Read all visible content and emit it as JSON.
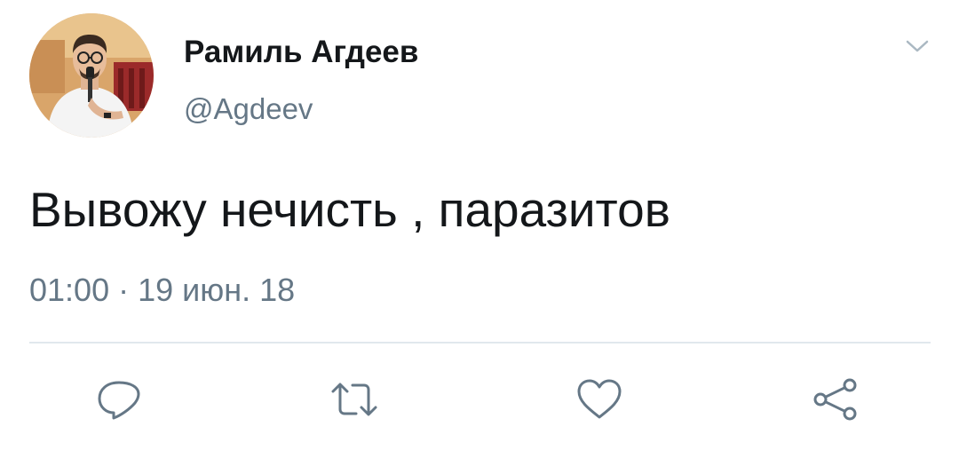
{
  "author": {
    "name": "Рамиль Агдеев",
    "handle": "@Agdeev"
  },
  "tweet": {
    "text": "Вывожу нечисть , паразитов",
    "timestamp": "01:00 · 19 июн. 18"
  },
  "icons": {
    "menu": "chevron-down-icon",
    "reply": "reply-icon",
    "retweet": "retweet-icon",
    "like": "heart-icon",
    "share": "share-icon"
  },
  "colors": {
    "text": "#14171a",
    "secondary": "#657786",
    "divider": "#e1e8ed"
  }
}
